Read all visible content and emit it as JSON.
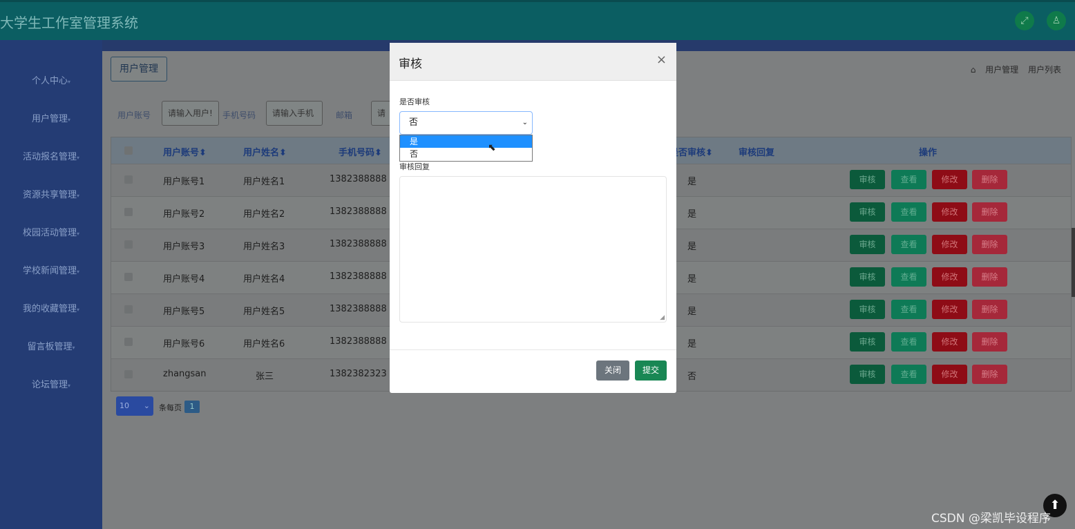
{
  "header": {
    "app_title": "大学生工作室管理系统",
    "icons": [
      "fullscreen-icon",
      "user-icon"
    ]
  },
  "sidebar": {
    "items": [
      {
        "label": "个人中心"
      },
      {
        "label": "用户管理"
      },
      {
        "label": "活动报名管理"
      },
      {
        "label": "资源共享管理"
      },
      {
        "label": "校园活动管理"
      },
      {
        "label": "学校新闻管理"
      },
      {
        "label": "我的收藏管理"
      },
      {
        "label": "留言板管理"
      },
      {
        "label": "论坛管理"
      }
    ]
  },
  "main": {
    "crumb_button": "用户管理",
    "breadcrumb": [
      "用户管理",
      "用户列表"
    ],
    "filters": [
      {
        "label": "用户账号",
        "placeholder": "请输入用户!"
      },
      {
        "label": "手机号码",
        "placeholder": "请输入手机"
      },
      {
        "label": "邮箱",
        "placeholder": "请"
      }
    ],
    "table": {
      "headers": [
        "用户账号",
        "用户姓名",
        "手机号码",
        "是否审核",
        "审核回复",
        "操作"
      ],
      "rows": [
        {
          "account": "用户账号1",
          "name": "用户姓名1",
          "phone": "1382388888",
          "audit": "是"
        },
        {
          "account": "用户账号2",
          "name": "用户姓名2",
          "phone": "1382388888",
          "audit": "是"
        },
        {
          "account": "用户账号3",
          "name": "用户姓名3",
          "phone": "1382388888",
          "audit": "是"
        },
        {
          "account": "用户账号4",
          "name": "用户姓名4",
          "phone": "1382388888",
          "audit": "是"
        },
        {
          "account": "用户账号5",
          "name": "用户姓名5",
          "phone": "1382388888",
          "audit": "是"
        },
        {
          "account": "用户账号6",
          "name": "用户姓名6",
          "phone": "1382388888",
          "audit": "是"
        },
        {
          "account": "zhangsan",
          "name": "张三",
          "phone": "1382382323",
          "audit": "否"
        }
      ],
      "actions": [
        "审核",
        "查看",
        "修改",
        "删除"
      ]
    },
    "pager": {
      "page_size": "10",
      "per_page_label": "条每页",
      "page": "1"
    }
  },
  "modal": {
    "title": "审核",
    "close_symbol": "×",
    "audit_label": "是否审核",
    "selected_value": "否",
    "options": [
      "是",
      "否"
    ],
    "reply_label": "审核回复",
    "buttons": {
      "close": "关闭",
      "submit": "提交"
    }
  },
  "watermark": "CSDN @梁凯毕设程序"
}
